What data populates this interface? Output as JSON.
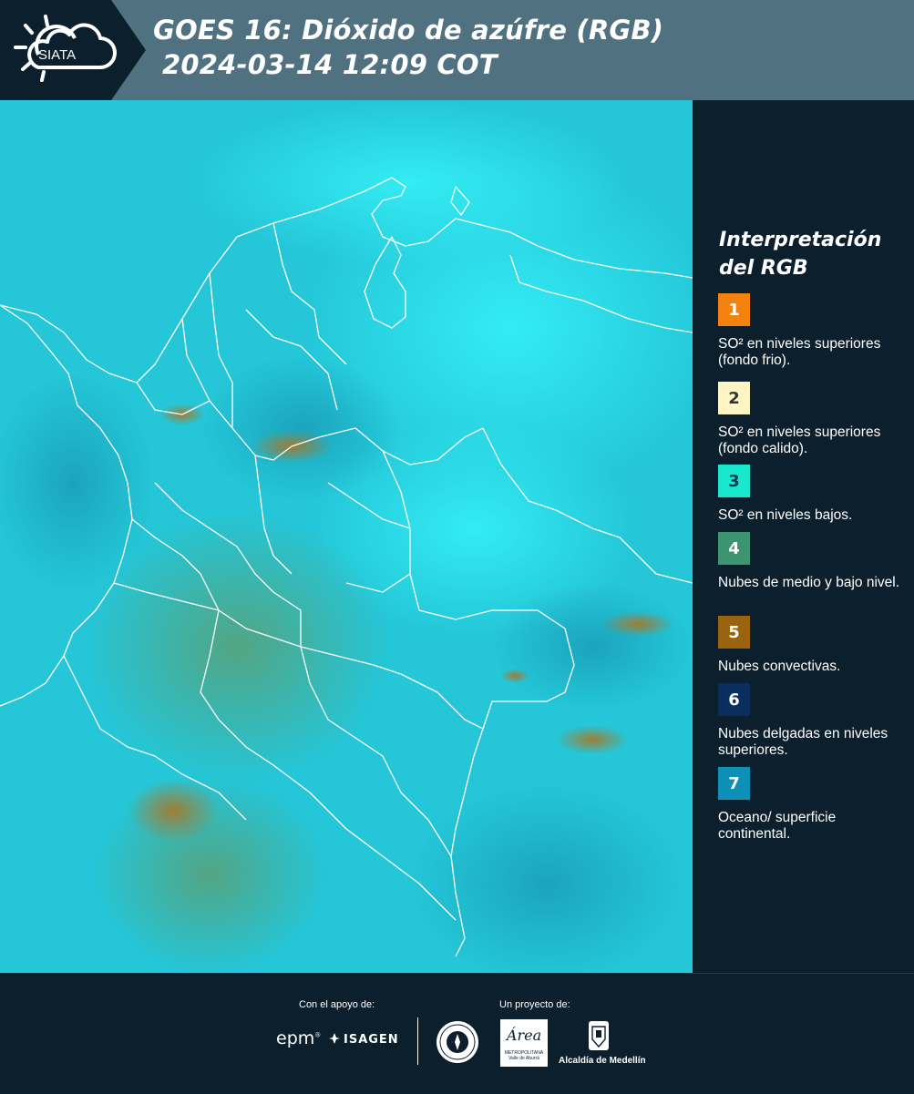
{
  "header": {
    "logo_text": "SIATA",
    "title_line1": "GOES 16: Dióxido de azúfre (RGB)",
    "title_line2": "2024-03-14 12:09 COT"
  },
  "map": {
    "icon": "satellite-rgb-map",
    "colors": {
      "background": "#22c4d6",
      "borders": "#ffffff"
    }
  },
  "legend": {
    "title_line1": "Interpretación",
    "title_line2": "del RGB",
    "items": [
      {
        "number": "1",
        "color": "#f4820f",
        "text_color": "#ffffff",
        "label": "SO² en niveles superiores (fondo frio)."
      },
      {
        "number": "2",
        "color": "#fdf6c4",
        "text_color": "#333333",
        "label": "SO² en niveles superiores (fondo calido)."
      },
      {
        "number": "3",
        "color": "#19e8cf",
        "text_color": "#0a3b4a",
        "label": "SO² en niveles bajos."
      },
      {
        "number": "4",
        "color": "#3d9470",
        "text_color": "#ffffff",
        "label": "Nubes de medio y bajo nivel."
      },
      {
        "number": "5",
        "color": "#9a640e",
        "text_color": "#ffffff",
        "label": "Nubes convectivas."
      },
      {
        "number": "6",
        "color": "#0a2e5e",
        "text_color": "#ffffff",
        "label": "Nubes delgadas en niveles superiores."
      },
      {
        "number": "7",
        "color": "#0d8fb6",
        "text_color": "#ffffff",
        "label": "Oceano/ superficie continental."
      }
    ]
  },
  "footer": {
    "support_label": "Con el apoyo de:",
    "project_label": "Un proyecto de:",
    "sponsor1": "epm",
    "sponsor1_mark": "®",
    "sponsor2": "ISAGEN",
    "area_logo_text": "Área",
    "area_logo_sub": "METROPOLITANA Valle de Aburrá",
    "alcaldia": "Alcaldía de Medellín"
  }
}
